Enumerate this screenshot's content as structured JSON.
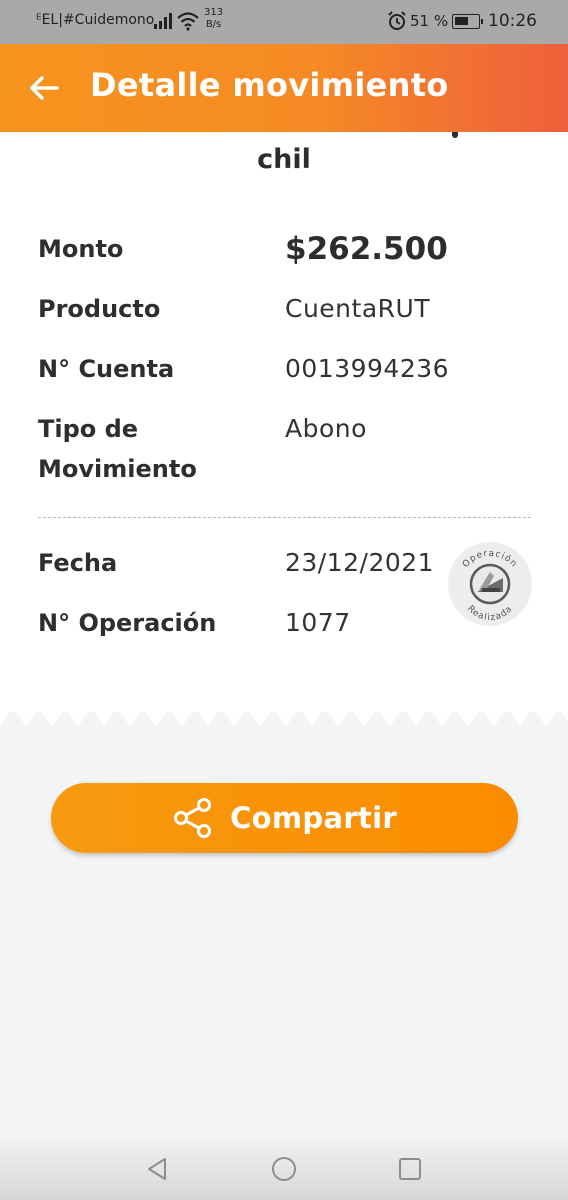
{
  "status_bar": {
    "carrier": "ᴱEL|#Cuidemono",
    "speed_value": "313",
    "speed_unit": "B/s",
    "battery": "51 %",
    "time": "10:26"
  },
  "header": {
    "title": "Detalle movimiento",
    "back_icon": "arrow-left-icon"
  },
  "receipt": {
    "name": "chil",
    "rows": [
      {
        "label": "Monto",
        "value": "$262.500"
      },
      {
        "label": "Producto",
        "value": "CuentaRUT"
      },
      {
        "label": "N° Cuenta",
        "value": "0013994236"
      },
      {
        "label": "Tipo de Movimiento",
        "value": "Abono"
      }
    ],
    "details": [
      {
        "label": "Fecha",
        "value": "23/12/2021"
      },
      {
        "label": "N° Operación",
        "value": "1077"
      }
    ],
    "stamp": {
      "top_text": "Operación",
      "bottom_text": "Realizada"
    }
  },
  "share_button": {
    "label": "Compartir",
    "icon": "share-icon"
  },
  "colors": {
    "header_start": "#f7941d",
    "header_end": "#ee5f3c",
    "button": "#fb8c00"
  }
}
